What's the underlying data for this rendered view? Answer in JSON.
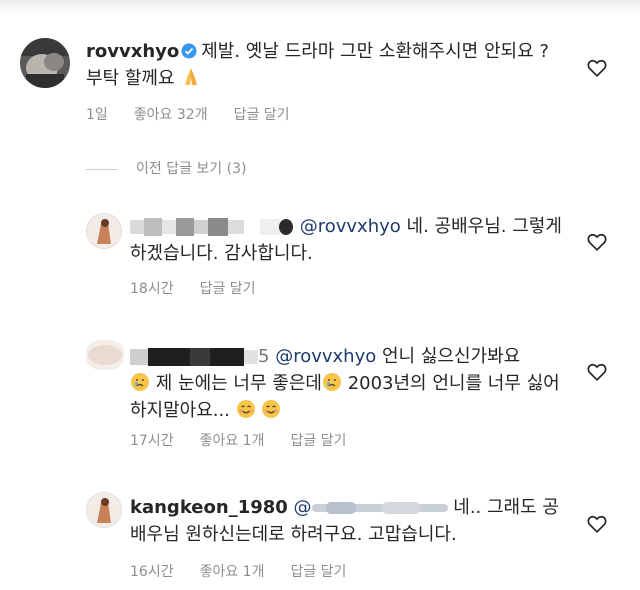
{
  "comments": [
    {
      "username": "rovvxhyo",
      "text": "제발. 옛날 드라마 그만 소환해주시면 안되요 ? 부탁 할께요",
      "time": "1일",
      "likes": "좋아요 32개",
      "reply": "답글 달기",
      "icons": [
        "verified-badge-icon",
        "folded-hands-emoji"
      ]
    },
    {
      "mention": "@rovvxhyo",
      "text": "네. 공배우님. 그렇게 하겠습니다. 감사합니다.",
      "time": "18시간",
      "reply": "답글 달기",
      "icons": [
        "blurred-username"
      ]
    },
    {
      "username_tail": "5",
      "mention": "@rovvxhyo",
      "text_a": "언니 싫으신가봐요",
      "text_b": "제 눈에는 너무 좋은데",
      "text_c": "2003년의 언니를 너무 싫어하지말아요...",
      "time": "17시간",
      "likes": "좋아요 1개",
      "reply": "답글 달기",
      "icons": [
        "blurred-username",
        "crying-face-emoji",
        "smiling-face-emoji"
      ]
    },
    {
      "username": "kangkeon_1980",
      "mention_visible": "@",
      "text": "네.. 그래도 공배우님 원하신는데로 하려구요. 고맙습니다.",
      "time": "16시간",
      "likes": "좋아요 1개",
      "reply": "답글 달기",
      "icons": [
        "blurred-mention"
      ]
    }
  ],
  "view_previous": "이전 답글 보기 (3)",
  "colors": {
    "text": "#262626",
    "meta": "#8e8e8e",
    "mention": "#1f3b6e",
    "verified": "#3897f0"
  }
}
